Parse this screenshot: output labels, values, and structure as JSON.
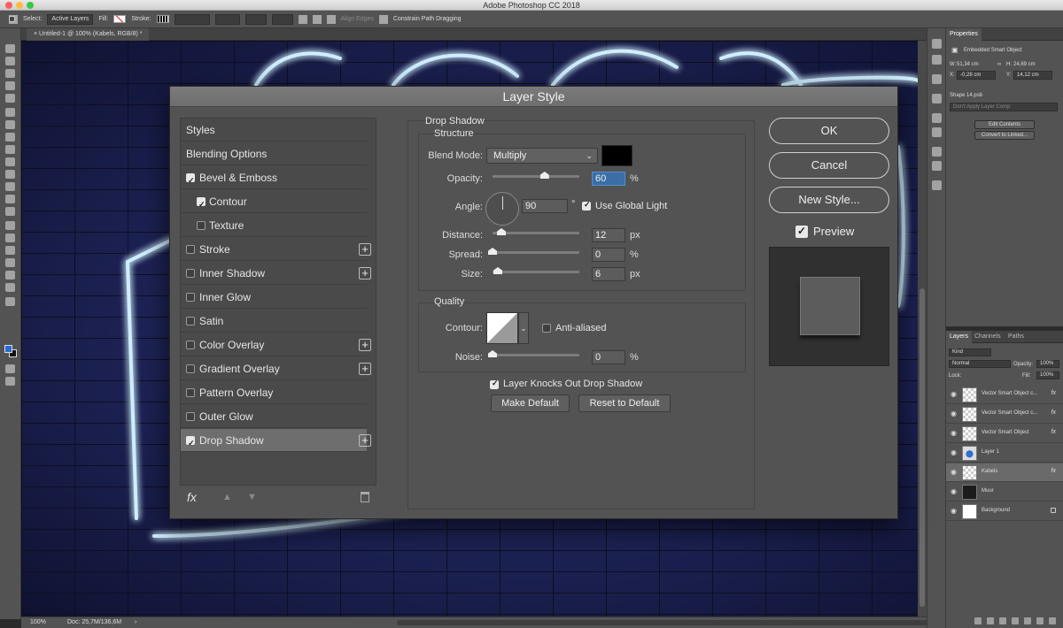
{
  "app": {
    "title": "Adobe Photoshop CC 2018"
  },
  "options_bar": {
    "select_label": "Select:",
    "select_value": "Active Layers",
    "fill_label": "Fill:",
    "stroke_label": "Stroke:",
    "align_edges": "Align Edges",
    "constrain": "Constrain Path Dragging"
  },
  "document": {
    "tab": "Untitled-1 @ 100% (Kabels, RGB/8) *"
  },
  "status_bar": {
    "zoom": "100%",
    "doc": "Doc: 25,7M/136,6M"
  },
  "properties": {
    "tab": "Properties",
    "type": "Embedded Smart Object",
    "w_label": "W:",
    "w": "51,34 cm",
    "h_label": "H:",
    "h": "24,69 cm",
    "x_label": "X:",
    "x": "-0,28 cm",
    "y_label": "Y:",
    "y": "14,12 cm",
    "file": "Shape 14.psb",
    "layer_comp": "Don't Apply Layer Comp",
    "edit_btn": "Edit Contents",
    "convert_btn": "Convert to Linked..."
  },
  "layers_panel": {
    "tabs": [
      "Layers",
      "Channels",
      "Paths"
    ],
    "kind": "Kind",
    "blend": "Normal",
    "opacity_label": "Opacity:",
    "opacity": "100%",
    "lock_label": "Lock:",
    "fill_label": "Fill:",
    "fill": "100%",
    "items": [
      {
        "name": "Vector Smart Object c...",
        "fx": "fx"
      },
      {
        "name": "Vector Smart Object c...",
        "fx": "fx"
      },
      {
        "name": "Vector Smart Object",
        "fx": "fx"
      },
      {
        "name": "Layer 1",
        "fx": ""
      },
      {
        "name": "Kabels",
        "fx": "fx"
      },
      {
        "name": "Muur",
        "fx": ""
      },
      {
        "name": "Background",
        "fx": ""
      }
    ]
  },
  "dialog": {
    "title": "Layer Style",
    "styles": [
      {
        "label": "Styles",
        "checkbox": null,
        "plus": false
      },
      {
        "label": "Blending Options",
        "checkbox": null,
        "plus": false
      },
      {
        "label": "Bevel & Emboss",
        "checkbox": true,
        "plus": false
      },
      {
        "label": "Contour",
        "checkbox": true,
        "plus": false
      },
      {
        "label": "Texture",
        "checkbox": false,
        "plus": false
      },
      {
        "label": "Stroke",
        "checkbox": false,
        "plus": true
      },
      {
        "label": "Inner Shadow",
        "checkbox": false,
        "plus": true
      },
      {
        "label": "Inner Glow",
        "checkbox": false,
        "plus": false
      },
      {
        "label": "Satin",
        "checkbox": false,
        "plus": false
      },
      {
        "label": "Color Overlay",
        "checkbox": false,
        "plus": true
      },
      {
        "label": "Gradient Overlay",
        "checkbox": false,
        "plus": true
      },
      {
        "label": "Pattern Overlay",
        "checkbox": false,
        "plus": false
      },
      {
        "label": "Outer Glow",
        "checkbox": false,
        "plus": false
      },
      {
        "label": "Drop Shadow",
        "checkbox": true,
        "plus": true
      }
    ],
    "fx_label": "fx",
    "section_title": "Drop Shadow",
    "structure_title": "Structure",
    "blend_mode_label": "Blend Mode:",
    "blend_mode": "Multiply",
    "shadow_color": "#000000",
    "opacity_label": "Opacity:",
    "opacity": "60",
    "opacity_unit": "%",
    "opacity_pct": 60,
    "angle_label": "Angle:",
    "angle": "90",
    "angle_unit": "°",
    "global_light_label": "Use Global Light",
    "distance_label": "Distance:",
    "distance": "12",
    "distance_unit": "px",
    "spread_label": "Spread:",
    "spread": "0",
    "spread_unit": "%",
    "size_label": "Size:",
    "size": "6",
    "size_unit": "px",
    "quality_title": "Quality",
    "contour_label": "Contour:",
    "anti_aliased_label": "Anti-aliased",
    "noise_label": "Noise:",
    "noise": "0",
    "noise_unit": "%",
    "knocks_out_label": "Layer Knocks Out Drop Shadow",
    "make_default": "Make Default",
    "reset_default": "Reset to Default",
    "ok": "OK",
    "cancel": "Cancel",
    "new_style": "New Style...",
    "preview": "Preview"
  }
}
